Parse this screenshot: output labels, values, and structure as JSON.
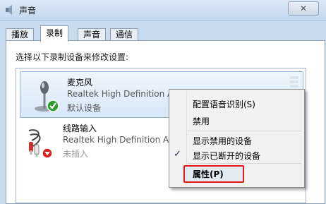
{
  "window": {
    "title": "声音",
    "close_label": "✕"
  },
  "tabs": [
    {
      "label": "播放"
    },
    {
      "label": "录制"
    },
    {
      "label": "声音"
    },
    {
      "label": "通信"
    }
  ],
  "prompt": "选择以下录制设备来修改设置:",
  "devices": [
    {
      "name": "麦克风",
      "driver": "Realtek High Definition Audi",
      "status": "默认设备"
    },
    {
      "name": "线路输入",
      "driver": "Realtek High Definition Audi",
      "status": "未插入"
    }
  ],
  "context_menu": {
    "items": [
      {
        "label": "配置语音识别(S)"
      },
      {
        "label": "禁用"
      },
      {
        "label": "显示禁用的设备"
      },
      {
        "label": "显示已断开的设备",
        "checked": true,
        "check": "✓"
      },
      {
        "label": "属性(P)"
      }
    ]
  }
}
